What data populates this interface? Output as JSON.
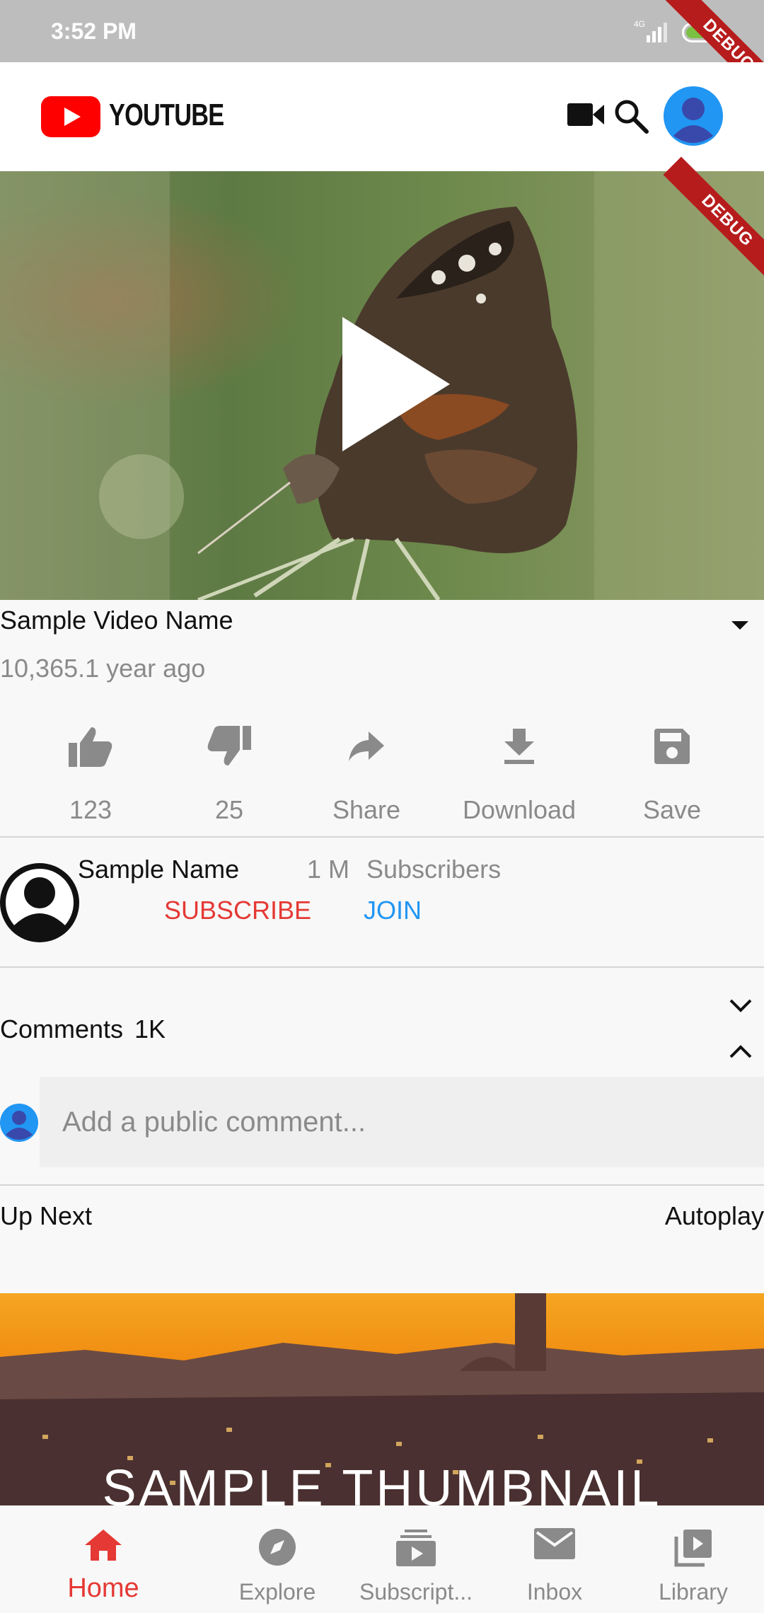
{
  "status_bar": {
    "time": "3:52 PM",
    "network": "4G",
    "battery": "38"
  },
  "debug_label": "DEBUG",
  "app_bar": {
    "logo_text": "YOUTUBE",
    "icons": [
      "video-camera-icon",
      "search-icon",
      "account-avatar-icon"
    ]
  },
  "video": {
    "title": "Sample Video Name",
    "meta": "10,365.1 year ago",
    "play_icon": "play-icon"
  },
  "actions": [
    {
      "icon": "thumb-up-icon",
      "label": "123"
    },
    {
      "icon": "thumb-down-icon",
      "label": "25"
    },
    {
      "icon": "share-icon",
      "label": "Share"
    },
    {
      "icon": "download-icon",
      "label": "Download"
    },
    {
      "icon": "save-icon",
      "label": "Save"
    }
  ],
  "channel": {
    "name": "Sample Name",
    "subscriber_count": "1 M",
    "subscriber_label": "Subscribers",
    "subscribe_label": "SUBSCRIBE",
    "join_label": "JOIN"
  },
  "comments": {
    "title": "Comments",
    "count": "1K",
    "placeholder": "Add a public comment..."
  },
  "up_next": {
    "label": "Up Next",
    "autoplay_label": "Autoplay",
    "thumbnail_text": "SAMPLE THUMBNAIL"
  },
  "bottom_nav": [
    {
      "icon": "home-icon",
      "label": "Home",
      "active": true
    },
    {
      "icon": "explore-icon",
      "label": "Explore",
      "active": false
    },
    {
      "icon": "subscriptions-icon",
      "label": "Subscript...",
      "active": false
    },
    {
      "icon": "inbox-icon",
      "label": "Inbox",
      "active": false
    },
    {
      "icon": "library-icon",
      "label": "Library",
      "active": false
    }
  ],
  "colors": {
    "accent_red": "#e53935",
    "join_blue": "#2196f3",
    "logo_red": "#ff0000",
    "avatar_blue": "#2196f3"
  }
}
